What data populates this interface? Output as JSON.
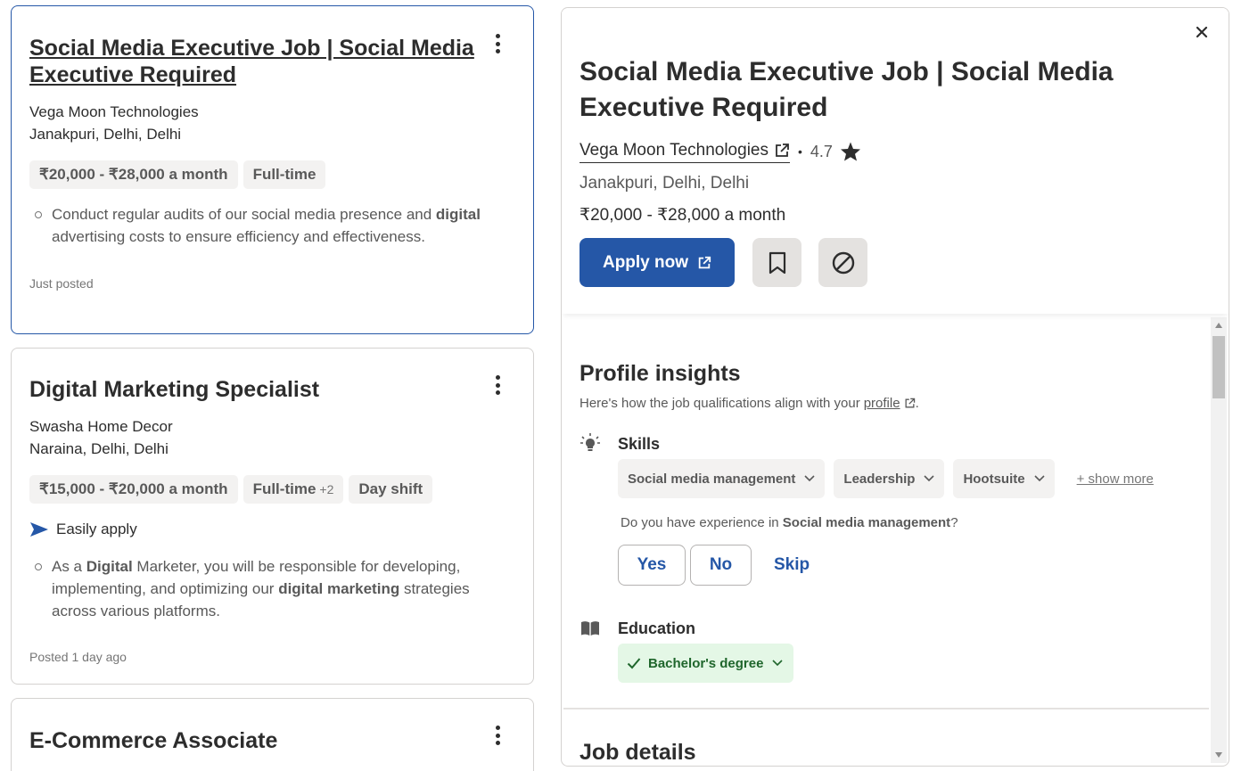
{
  "jobs": [
    {
      "title": "Social Media Executive Job | Social Media Executive Required",
      "company": "Vega Moon Technologies",
      "location": "Janakpuri, Delhi, Delhi",
      "salary": "₹20,000 - ₹28,000 a month",
      "type": "Full-time",
      "snippet": {
        "pre": "Conduct regular audits of our social media presence and ",
        "b1": "digital",
        "post": " advertising costs to ensure efficiency and effectiveness."
      },
      "posted": "Just posted"
    },
    {
      "title": "Digital Marketing Specialist",
      "company": "Swasha Home Decor",
      "location": "Naraina, Delhi, Delhi",
      "salary": "₹15,000 - ₹20,000 a month",
      "type": "Full-time",
      "type_extra": "+2",
      "shift": "Day shift",
      "easily_apply": "Easily apply",
      "snippet": {
        "pre": "As a ",
        "b1": "Digital",
        "mid": " Marketer, you will be responsible for developing, implementing, and optimizing our ",
        "b2": "digital marketing",
        "post": " strategies across various platforms."
      },
      "posted": "Posted 1 day ago"
    },
    {
      "title": "E-Commerce Associate"
    }
  ],
  "detail": {
    "title": "Social Media Executive Job | Social Media Executive Required",
    "company": "Vega Moon Technologies",
    "rating": "4.7",
    "location": "Janakpuri, Delhi, Delhi",
    "salary": "₹20,000 - ₹28,000 a month",
    "apply_label": "Apply now",
    "insights": {
      "title": "Profile insights",
      "subtitle": "Here's how the job qualifications align with your",
      "profile_link": "profile",
      "period": ".",
      "skills_label": "Skills",
      "skills": [
        "Social media management",
        "Leadership",
        "Hootsuite"
      ],
      "show_more": "+ show more",
      "question_pre": "Do you have experience in ",
      "question_skill": "Social media management",
      "question_post": "?",
      "yes": "Yes",
      "no": "No",
      "skip": "Skip",
      "education_label": "Education",
      "education_value": "Bachelor's degree"
    },
    "job_details_title": "Job details"
  },
  "colors": {
    "primary": "#2557a7",
    "text": "#2d2d2d",
    "muted": "#595959",
    "success_bg": "#e4f7e6",
    "success_text": "#1f662c"
  }
}
